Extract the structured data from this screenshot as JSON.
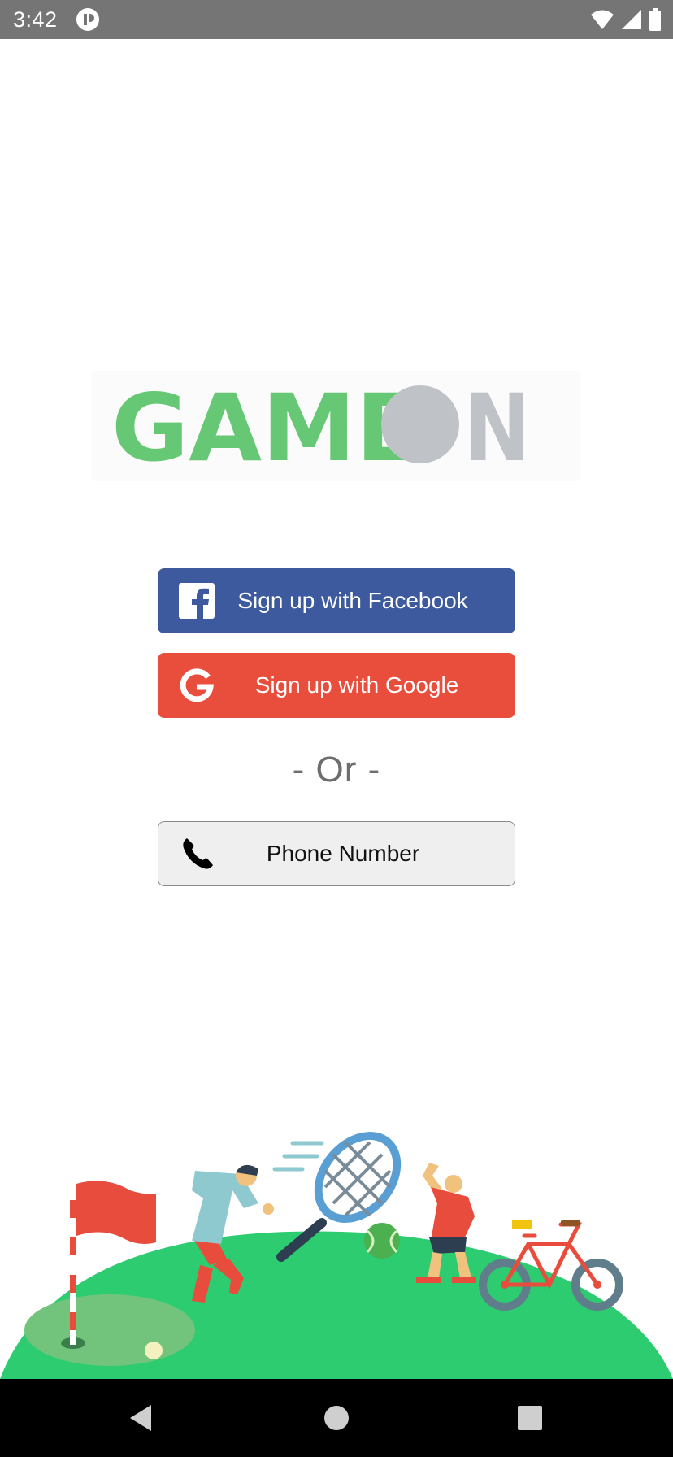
{
  "status_bar": {
    "time": "3:42",
    "icons": [
      "app-notification-icon",
      "wifi-icon",
      "cellular-signal-icon",
      "battery-icon"
    ]
  },
  "logo": {
    "text_green": "GAME",
    "text_gray": "N",
    "colors": {
      "green": "#66c874",
      "gray": "#bfc2c6"
    }
  },
  "buttons": {
    "facebook": {
      "label": "Sign up with Facebook",
      "icon": "facebook-icon",
      "color": "#3d5a9f"
    },
    "google": {
      "label": "Sign up with Google",
      "icon": "google-icon",
      "color": "#e94e3d"
    },
    "phone": {
      "label": "Phone Number",
      "icon": "phone-icon",
      "color": "#efefef"
    }
  },
  "divider": {
    "text": "- Or -"
  },
  "illustration": {
    "items": [
      "golf-flag",
      "golf-ball",
      "runner",
      "tennis-racket",
      "tennis-ball",
      "stretching-person",
      "bicycle"
    ],
    "hill_color": "#2ecc71"
  },
  "nav_bar": {
    "buttons": [
      "back-icon",
      "home-icon",
      "recents-icon"
    ]
  }
}
